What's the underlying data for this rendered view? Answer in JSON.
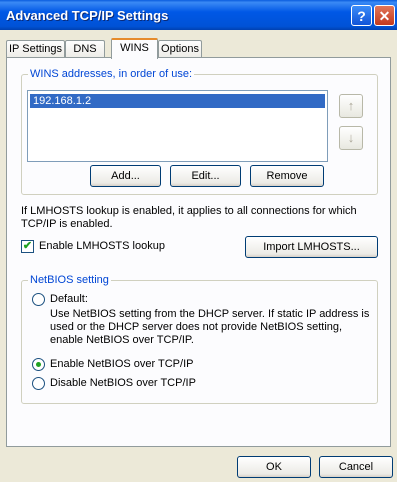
{
  "window": {
    "title": "Advanced TCP/IP Settings"
  },
  "titlebar": {
    "help_glyph": "?",
    "close_glyph": "✕"
  },
  "tabs": [
    {
      "label": "IP Settings",
      "active": false
    },
    {
      "label": "DNS",
      "active": false
    },
    {
      "label": "WINS",
      "active": true
    },
    {
      "label": "Options",
      "active": false
    }
  ],
  "wins": {
    "group_label": "WINS addresses, in order of use:",
    "addresses": [
      "192.168.1.2"
    ],
    "up_icon": "up-arrow-icon",
    "down_icon": "down-arrow-icon",
    "add_label": "Add...",
    "edit_label": "Edit...",
    "remove_label": "Remove"
  },
  "lmhosts": {
    "info_text": "If LMHOSTS lookup is enabled, it applies to all connections for which TCP/IP is enabled.",
    "enable_label": "Enable LMHOSTS lookup",
    "enable_checked": true,
    "import_label": "Import LMHOSTS..."
  },
  "netbios": {
    "group_label": "NetBIOS setting",
    "default_label": "Default:",
    "default_desc": "Use NetBIOS setting from the DHCP server. If static IP address is used or the DHCP server does not provide NetBIOS setting, enable NetBIOS over TCP/IP.",
    "enable_label": "Enable NetBIOS over TCP/IP",
    "disable_label": "Disable NetBIOS over TCP/IP",
    "selected": "enable"
  },
  "footer": {
    "ok_label": "OK",
    "cancel_label": "Cancel"
  }
}
